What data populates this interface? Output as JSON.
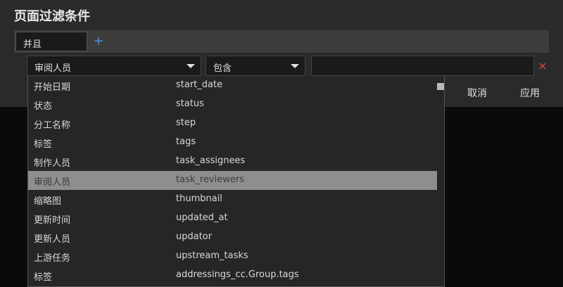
{
  "header": {
    "title": "页面过滤条件"
  },
  "logic": {
    "value": "并且",
    "add_icon": "+"
  },
  "condition": {
    "field": "审阅人员",
    "operator": "包含",
    "value": "",
    "remove_icon": "×"
  },
  "actions": {
    "cancel_label": "取消",
    "apply_label": "应用"
  },
  "dropdown": {
    "selected_index": 5,
    "items": [
      {
        "label": "开始日期",
        "field": "start_date"
      },
      {
        "label": "状态",
        "field": "status"
      },
      {
        "label": "分工名称",
        "field": "step"
      },
      {
        "label": "标签",
        "field": "tags"
      },
      {
        "label": "制作人员",
        "field": "task_assignees"
      },
      {
        "label": "审阅人员",
        "field": "task_reviewers"
      },
      {
        "label": "缩略图",
        "field": "thumbnail"
      },
      {
        "label": "更新时间",
        "field": "updated_at"
      },
      {
        "label": "更新人员",
        "field": "updator"
      },
      {
        "label": "上游任务",
        "field": "upstream_tasks"
      },
      {
        "label": "标签",
        "field": "addressings_cc.Group.tags"
      }
    ]
  },
  "colors": {
    "accent": "#4a8fe0",
    "danger": "#e04545",
    "selected_row": "#8e8e8e"
  }
}
